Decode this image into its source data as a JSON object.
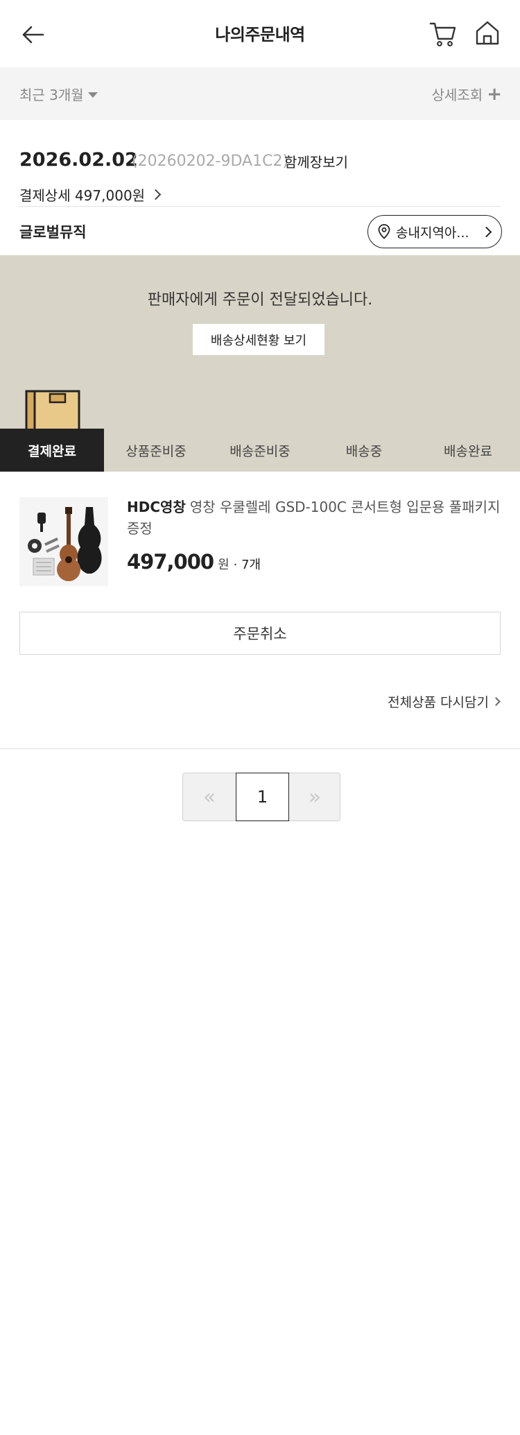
{
  "header": {
    "title": "나의주문내역"
  },
  "filter": {
    "period_label": "최근 3개월",
    "detail_label": "상세조회"
  },
  "order": {
    "date": "2026.02.02",
    "order_no": "(20260202-9DA1C2)",
    "view_together": "함께장보기",
    "payment_detail": "결제상세 497,000원",
    "seller": "글로벌뮤직",
    "location_button": "송내지역아..."
  },
  "status_banner": {
    "message": "판매자에게 주문이 전달되었습니다.",
    "track_button": "배송상세현황 보기"
  },
  "steps": [
    {
      "label": "결제완료",
      "active": true
    },
    {
      "label": "상품준비중",
      "active": false
    },
    {
      "label": "배송준비중",
      "active": false
    },
    {
      "label": "배송중",
      "active": false
    },
    {
      "label": "배송완료",
      "active": false
    }
  ],
  "product": {
    "brand": "HDC영창",
    "name": "영창 우쿨렐레 GSD-100C 콘서트형 입문용 풀패키지증정",
    "price": "497,000",
    "unit": "원",
    "qty": "· 7개"
  },
  "actions": {
    "cancel_label": "주문취소",
    "recart_label": "전체상품 다시담기"
  },
  "pagination": {
    "prev_glyph": "«",
    "current_page": "1",
    "next_glyph": "»"
  },
  "colors": {
    "banner_bg": "#d8d4c7",
    "active_step_bg": "#222222",
    "filter_bg": "#f4f4f4"
  }
}
